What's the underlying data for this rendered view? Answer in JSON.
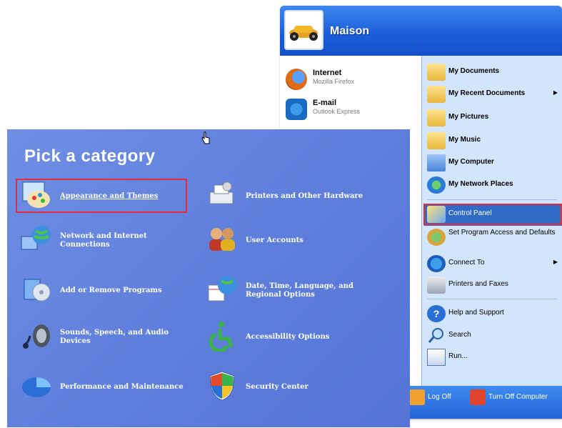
{
  "start_menu": {
    "user_name": "Maison",
    "pinned": [
      {
        "title": "Internet",
        "subtitle": "Mozilla Firefox"
      },
      {
        "title": "E-mail",
        "subtitle": "Outlook Express"
      }
    ],
    "right": [
      {
        "label": "My Documents"
      },
      {
        "label": "My Recent Documents"
      },
      {
        "label": "My Pictures"
      },
      {
        "label": "My Music"
      },
      {
        "label": "My Computer"
      },
      {
        "label": "My Network Places"
      },
      {
        "label": "Control Panel"
      },
      {
        "label": "Set Program Access and Defaults"
      },
      {
        "label": "Connect To"
      },
      {
        "label": "Printers and Faxes"
      },
      {
        "label": "Help and Support"
      },
      {
        "label": "Search"
      },
      {
        "label": "Run..."
      }
    ],
    "footer": {
      "log_off": "Log Off",
      "turn_off": "Turn Off Computer"
    }
  },
  "control_panel": {
    "title": "Pick a category",
    "categories": [
      {
        "label": "Appearance and Themes"
      },
      {
        "label": "Network and Internet Connections"
      },
      {
        "label": "Add or Remove Programs"
      },
      {
        "label": "Sounds, Speech, and Audio Devices"
      },
      {
        "label": "Performance and Maintenance"
      },
      {
        "label": "Printers and Other Hardware"
      },
      {
        "label": "User Accounts"
      },
      {
        "label": "Date, Time, Language, and Regional Options"
      },
      {
        "label": "Accessibility Options"
      },
      {
        "label": "Security Center"
      }
    ]
  },
  "colors": {
    "header_blue": "#1a5cd8",
    "right_pane": "#d3e5fa",
    "panel_blue": "#5f7fdc",
    "highlight_red": "#e42c3b",
    "selection_blue": "#316ac5"
  }
}
